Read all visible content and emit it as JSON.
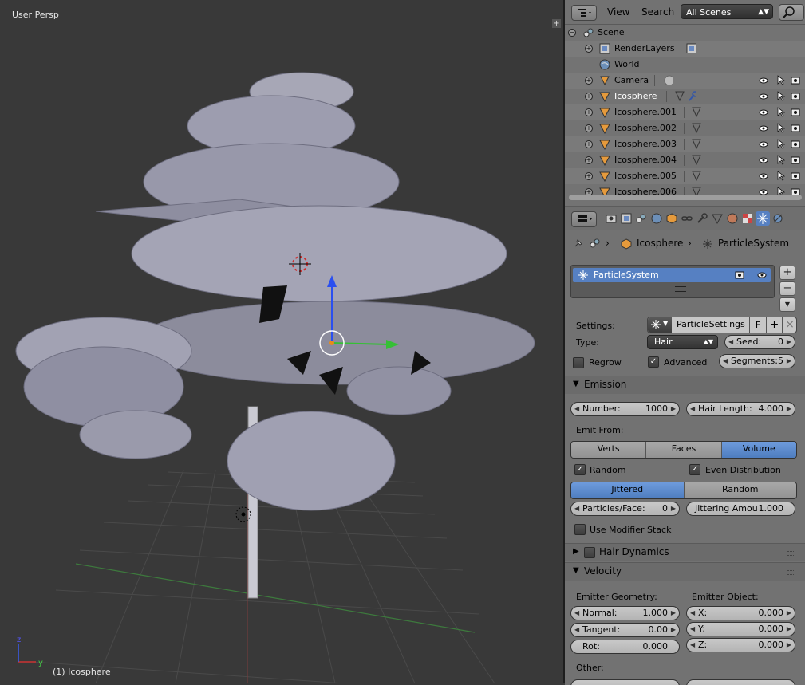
{
  "viewport": {
    "title": "User Persp",
    "status": "(1) Icosphere",
    "corner_plus": "+",
    "axis_y": "y",
    "axis_z": "z"
  },
  "outliner": {
    "menu_view": "View",
    "menu_search": "Search",
    "scene_select": "All Scenes",
    "rows": [
      {
        "label": "Scene",
        "expander": "−"
      },
      {
        "label": "RenderLayers",
        "expander": "+"
      },
      {
        "label": "World",
        "expander": ""
      },
      {
        "label": "Camera",
        "expander": "+"
      },
      {
        "label": "Icosphere",
        "expander": "+"
      },
      {
        "label": "Icosphere.001",
        "expander": "+"
      },
      {
        "label": "Icosphere.002",
        "expander": "+"
      },
      {
        "label": "Icosphere.003",
        "expander": "+"
      },
      {
        "label": "Icosphere.004",
        "expander": "+"
      },
      {
        "label": "Icosphere.005",
        "expander": "+"
      },
      {
        "label": "Icosphere.006",
        "expander": "+"
      }
    ]
  },
  "properties": {
    "breadcrumb_object": "Icosphere",
    "breadcrumb_system": "ParticleSystem",
    "list_item": "ParticleSystem",
    "settings_label": "Settings:",
    "settings_value": "ParticleSettings",
    "settings_f": "F",
    "type_label": "Type:",
    "type_value": "Hair",
    "seed_label": "Seed:",
    "seed_value": "0",
    "regrow_label": "Regrow",
    "advanced_label": "Advanced",
    "segments_label": "Segments:",
    "segments_value": "5",
    "emission_title": "Emission",
    "number_label": "Number:",
    "number_value": "1000",
    "hair_length_label": "Hair Length:",
    "hair_length_value": "4.000",
    "emit_from_label": "Emit From:",
    "emit_from_options": [
      "Verts",
      "Faces",
      "Volume"
    ],
    "random_label": "Random",
    "even_distribution_label": "Even Distribution",
    "distribution_options": [
      "Jittered",
      "Random"
    ],
    "particles_face_label": "Particles/Face:",
    "particles_face_value": "0",
    "jittering_label": "Jittering Amou",
    "jittering_value": "1.000",
    "use_modifier_stack_label": "Use Modifier Stack",
    "hair_dynamics_title": "Hair Dynamics",
    "velocity_title": "Velocity",
    "emitter_geometry_label": "Emitter Geometry:",
    "emitter_object_label": "Emitter Object:",
    "normal_label": "Normal:",
    "normal_value": "1.000",
    "tangent_label": "Tangent:",
    "tangent_value": "0.00",
    "rot_label": "Rot:",
    "rot_value": "0.000",
    "x_label": "X:",
    "x_value": "0.000",
    "y_label": "Y:",
    "y_value": "0.000",
    "z_label": "Z:",
    "z_value": "0.000",
    "other_label": "Other:",
    "check_mark": "✓",
    "add_symbol": "+",
    "remove_symbol": "−",
    "close_symbol": "×",
    "expand_symbol": "▼",
    "collapse_symbol": "▶",
    "breadcrumb_sep": "›"
  },
  "colors": {
    "selection_blue": "#5680c2",
    "viewport_bg": "#393939",
    "panel_bg": "#727272"
  }
}
